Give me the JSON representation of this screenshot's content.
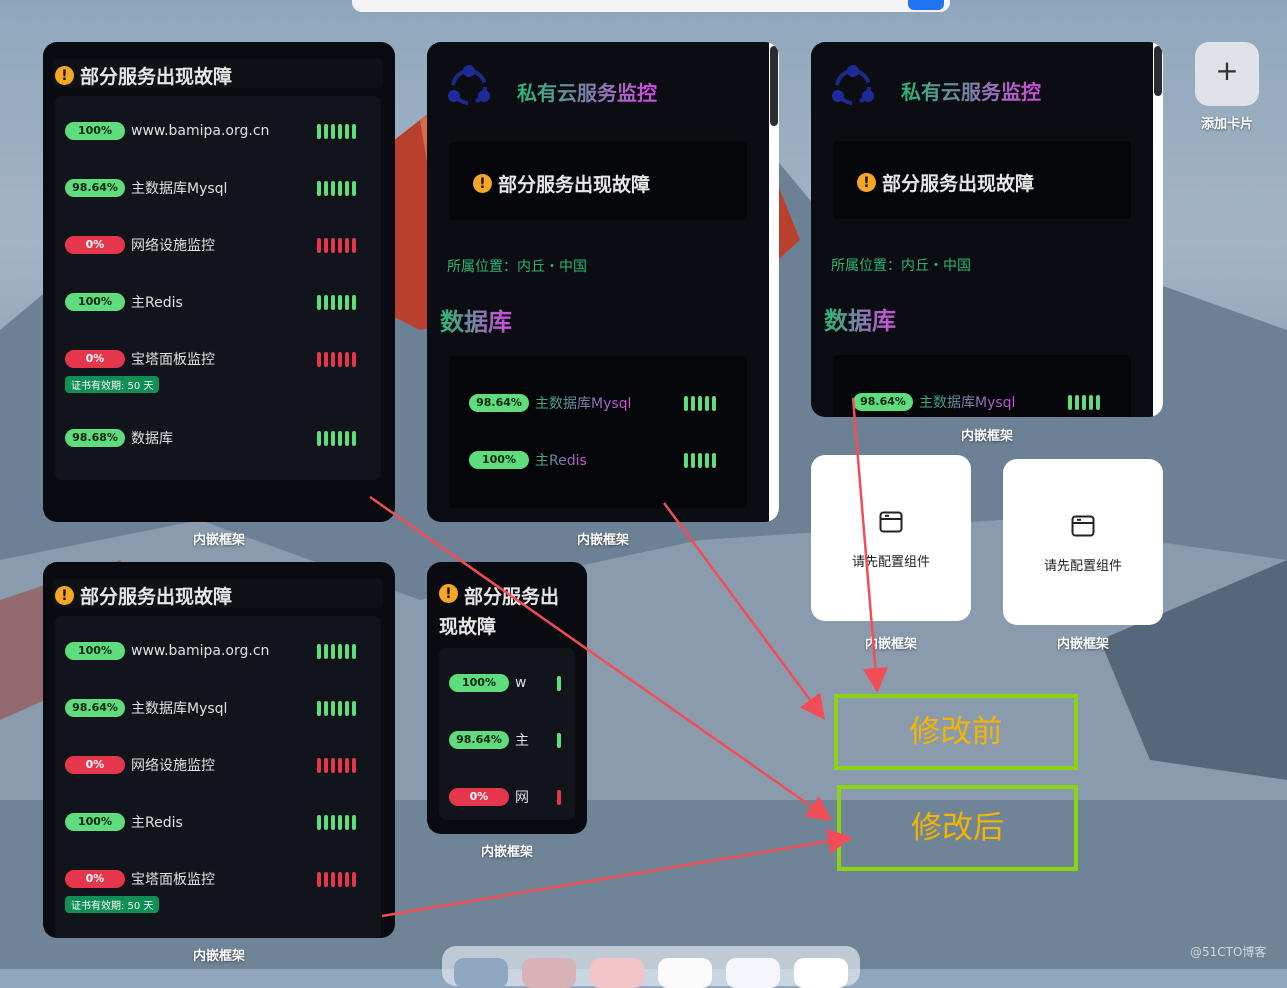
{
  "colors": {
    "ok": "#5fdc7d",
    "fail": "#e5364b",
    "warning": "#f5a623",
    "annotation_border": "#8bd414",
    "annotation_text": "#f5b400",
    "arrow": "#f24d57"
  },
  "add_card": {
    "label": "添加卡片",
    "icon": "plus-icon"
  },
  "captions": {
    "embedded_frame": "内嵌框架"
  },
  "status": {
    "warning_text": "部分服务出现故障",
    "warning_text_narrow_l1": "部分服务出",
    "warning_text_narrow_l2": "现故障"
  },
  "card1": {
    "services": [
      {
        "percent": "100%",
        "name": "www.bamipa.org.cn",
        "state": "ok"
      },
      {
        "percent": "98.64%",
        "name": "主数据库Mysql",
        "state": "ok"
      },
      {
        "percent": "0%",
        "name": "网络设施监控",
        "state": "fail"
      },
      {
        "percent": "100%",
        "name": "主Redis",
        "state": "ok"
      },
      {
        "percent": "0%",
        "name": "宝塔面板监控",
        "state": "fail",
        "cert": "证书有效期: 50 天"
      },
      {
        "percent": "98.68%",
        "name": "数据库",
        "state": "ok"
      }
    ]
  },
  "monitor": {
    "title": "私有云服务监控",
    "location": "所属位置：内丘・中国",
    "section": "数据库",
    "services": [
      {
        "percent": "98.64%",
        "name": "主数据库Mysql"
      },
      {
        "percent": "100%",
        "name": "主Redis"
      }
    ]
  },
  "card_narrow": {
    "services": [
      {
        "percent": "100%",
        "name": "w"
      },
      {
        "percent": "98.64%",
        "name": "主"
      },
      {
        "percent": "0%",
        "name": "网"
      }
    ]
  },
  "placeholder": {
    "label": "请先配置组件",
    "icon": "window-icon"
  },
  "annotations": {
    "before": "修改前",
    "after": "修改后"
  },
  "watermark": "@51CTO博客"
}
